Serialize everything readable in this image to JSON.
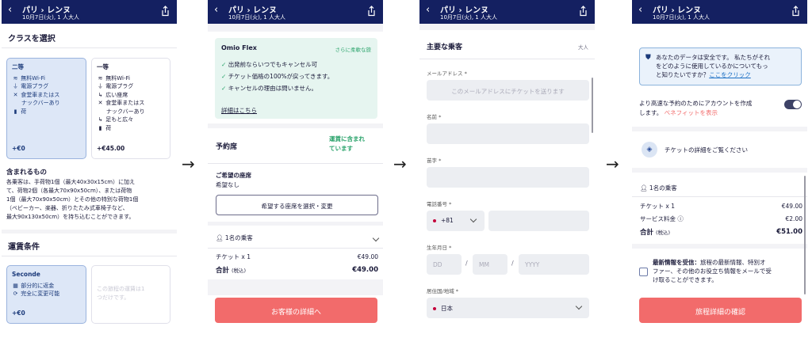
{
  "header": {
    "title": "パリ › レンヌ",
    "subtitle": "10月7日(火), 1 人大人"
  },
  "screen1": {
    "class_title": "クラスを選択",
    "second": {
      "name": "二等",
      "features": [
        "無料Wi-Fi",
        "電源プラグ",
        "食堂車またはス",
        "ナックバーあり",
        "荷"
      ],
      "price": "+€0"
    },
    "first": {
      "name": "一等",
      "features": [
        "無料Wi-Fi",
        "電源プラグ",
        "広い座席",
        "食堂車またはス",
        "ナックバーあり",
        "足もと広々",
        "荷"
      ],
      "price": "+€45.00"
    },
    "included_title": "含まれるもの",
    "included_text": [
      "各乗客は、手荷物1個（最大40x30x15cm）に加え",
      "て、荷物2個（各最大70x90x50cm）、または荷物",
      "1個（最大70x90x50cm）とその他の特別な荷物1個",
      "（ベビーカー、楽器、折りたたみ式車椅子など、",
      "最大90x130x50cm）を持ち込むことができます。"
    ],
    "fare_title": "運賃条件",
    "seconde": {
      "name": "Seconde",
      "features": [
        "部分的に返金",
        "完全に変更可能"
      ],
      "price": "+€0"
    },
    "unavailable": [
      "この旅程の運賃は1",
      "つだけです。"
    ]
  },
  "screen2": {
    "flex_title": "Omio Flex",
    "flex_tag": "さらに柔軟な旅",
    "flex_items": [
      "出発前ならいつでもキャンセル可",
      "チケット価格の100%が戻ってきます。",
      "キャンセルの理由は問いません。"
    ],
    "flex_link": "詳細はこちら",
    "reserve_title": "予約席",
    "reserve_note": [
      "運賃に含まれ",
      "ています"
    ],
    "pref_title": "ご希望の座席",
    "pref_value": "希望なし",
    "pref_button": "希望する座席を選択・変更",
    "pax": "1名の乗客",
    "ticket_label": "チケット x 1",
    "ticket_price": "€49.00",
    "total_label": "合計",
    "total_tax": "(税込)",
    "total_price": "€49.00",
    "cta": "お客様の詳細へ"
  },
  "screen3": {
    "main_title": "主要な乗客",
    "main_tag": "大人",
    "email_label": "メールアドレス *",
    "email_placeholder": "このメールアドレスにチケットを送ります",
    "first_name_label": "名前 *",
    "last_name_label": "苗字 *",
    "phone_label": "電話番号 *",
    "phone_code": "+81",
    "dob_label": "生年月日 *",
    "dd": "DD",
    "mm": "MM",
    "yyyy": "YYYY",
    "country_label": "居住国/地域 *",
    "country_value": "日本"
  },
  "screen4": {
    "safe_text": [
      "あなたのデータは安全です。 私たちがそれ",
      "をどのように使用しているかについてもっ",
      "と知りたいですか？"
    ],
    "safe_link": "ここをクリック",
    "account_text": [
      "より高速な予約のためにアカウントを作成",
      "します。"
    ],
    "benefit_link": "ベネフィットを表示",
    "ticket_details": "チケットの詳細をご覧ください",
    "pax": "1名の乗客",
    "ticket_label": "チケット x 1",
    "ticket_price": "€49.00",
    "service_label": "サービス料金",
    "service_price": "€2.00",
    "total_label": "合計",
    "total_tax": "(税込)",
    "total_price": "€51.00",
    "news_bold": "最新情報を受信：",
    "news_text": [
      "旅程の最新情報、特別オ",
      "ファー、その他のお役立ち情報をメールで受",
      "け取ることができます。"
    ],
    "cta": "旅程詳細の確認"
  },
  "arrow": "→",
  "colors": {
    "header": "#142061",
    "accent": "#f26b6b",
    "link": "#1b6fc4",
    "green": "#2aa36b"
  }
}
